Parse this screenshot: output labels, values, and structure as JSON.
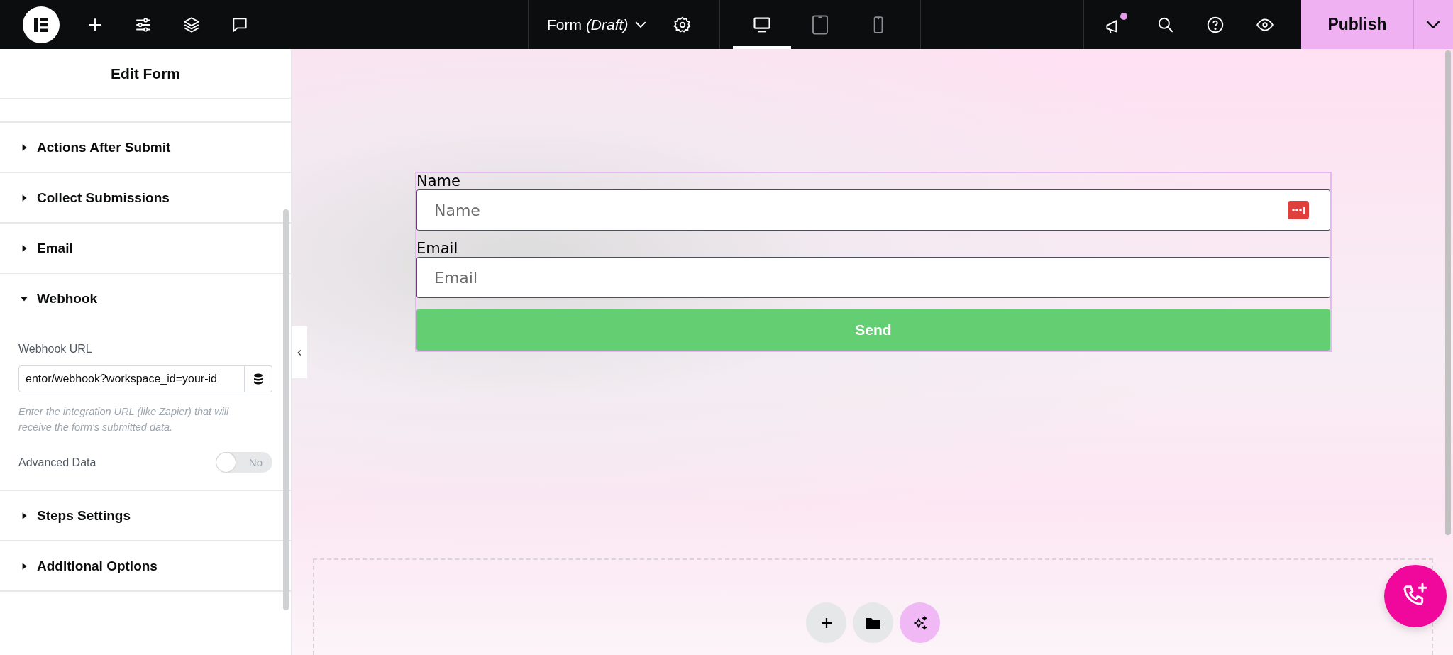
{
  "topbar": {
    "document": {
      "title": "Form",
      "status": "(Draft)"
    },
    "devices": [
      {
        "kind": "desktop",
        "selected": true
      },
      {
        "kind": "tablet",
        "selected": false
      },
      {
        "kind": "mobile",
        "selected": false
      }
    ],
    "notification_unread": true,
    "publish": "Publish"
  },
  "panel": {
    "title": "Edit Form",
    "sections": [
      {
        "label": "Actions After Submit",
        "expanded": false
      },
      {
        "label": "Collect Submissions",
        "expanded": false
      },
      {
        "label": "Email",
        "expanded": false
      },
      {
        "label": "Webhook",
        "expanded": true,
        "kind": "webhook"
      },
      {
        "label": "Steps Settings",
        "expanded": false
      },
      {
        "label": "Additional Options",
        "expanded": false
      }
    ],
    "webhook": {
      "url_label": "Webhook URL",
      "url_value": "entor/webhook?workspace_id=your-id",
      "help": "Enter the integration URL (like Zapier) that will receive the form's submitted data.",
      "toggle_label": "Advanced Data",
      "toggle_on": false,
      "toggle_text": "No"
    }
  },
  "form": {
    "fields": [
      {
        "label": "Name",
        "placeholder": "Name",
        "password_manager": true
      },
      {
        "label": "Email",
        "placeholder": "Email",
        "password_manager": false
      }
    ],
    "submit": "Send"
  }
}
